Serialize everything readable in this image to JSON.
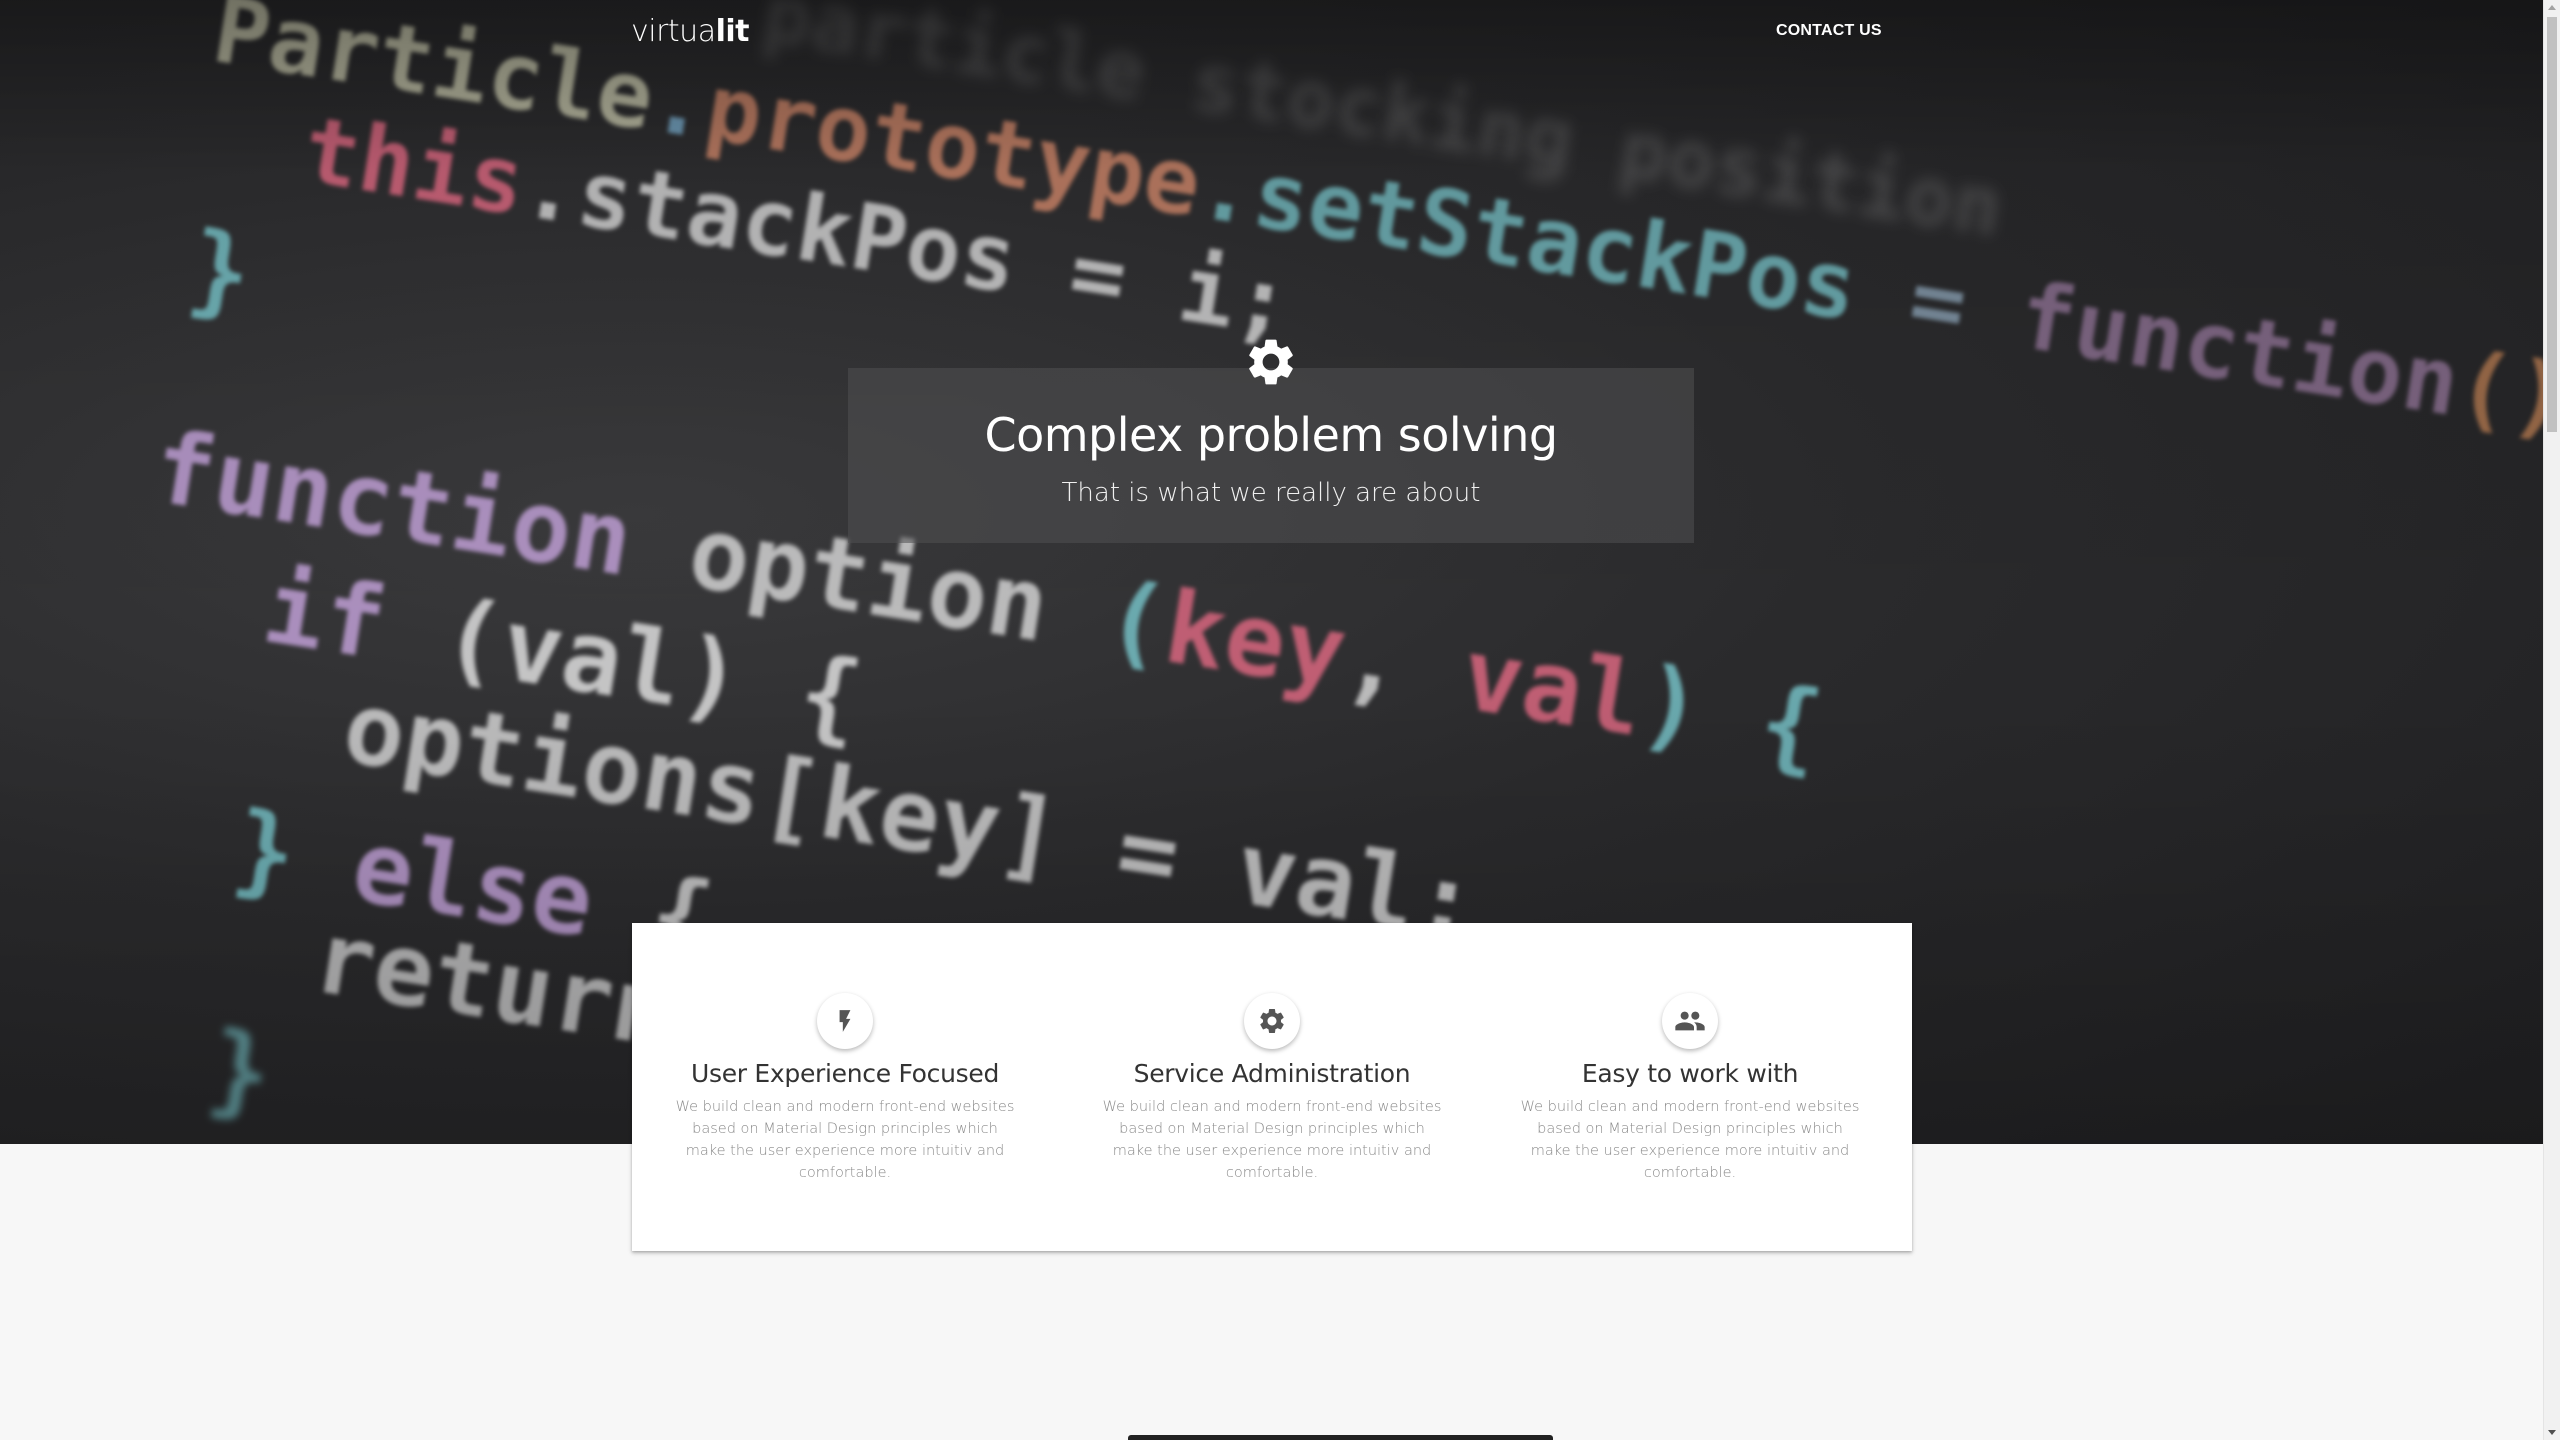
{
  "nav": {
    "logo_light": "virtua",
    "logo_bold": "lit",
    "contact_label": "CONTACT US"
  },
  "hero": {
    "icon": "gear-icon",
    "title": "Complex problem solving",
    "subtitle": "That is what we really are about",
    "background_code": [
      "Particle stocking position",
      "Particle.prototype.setStackPos = function() {",
      "this.stackPos = i;",
      "}",
      "function option (key, val) {",
      "if (val) {",
      "options[key] = val;",
      "} else {",
      "return"
    ]
  },
  "features": [
    {
      "icon": "lightning-icon",
      "title": "User Experience Focused",
      "text": "We build clean and modern front-end websites based on Material Design principles which make the user experience more intuitiv and comfortable."
    },
    {
      "icon": "gear-icon",
      "title": "Service Administration",
      "text": "We build clean and modern front-end websites based on Material Design principles which make the user experience more intuitiv and comfortable."
    },
    {
      "icon": "people-icon",
      "title": "Easy to work with",
      "text": "We build clean and modern front-end websites based on Material Design principles which make the user experience more intuitiv and comfortable."
    }
  ],
  "colors": {
    "hero_dark": "#2a2a2c",
    "card_white": "#ffffff",
    "code_pink": "#d9667f",
    "code_cyan": "#7fd3d8",
    "code_white": "#e8e8e8",
    "code_orange": "#e0935a"
  }
}
